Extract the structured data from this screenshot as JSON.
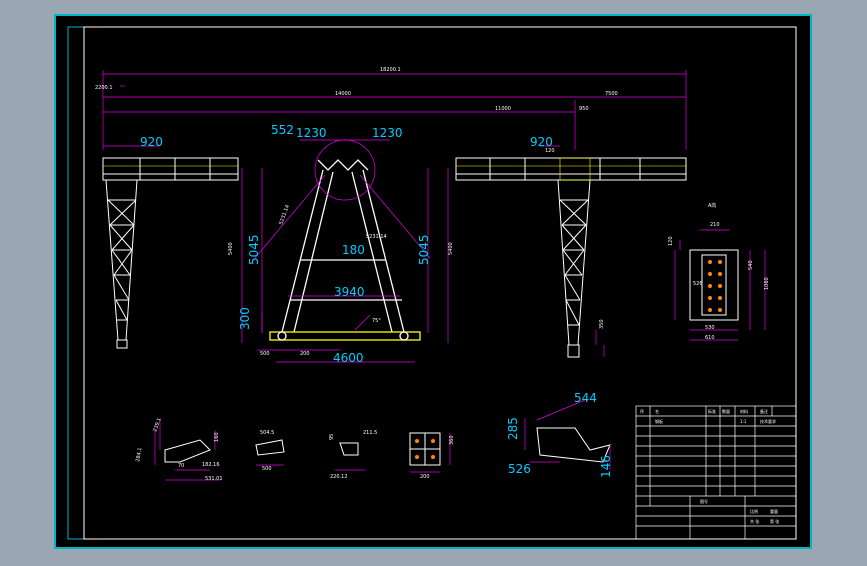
{
  "colors": {
    "background": "#9aa6b2",
    "sheet": "#000000",
    "frame": "#ffffff",
    "border": "#00b4c8",
    "structure": "#ffffff",
    "dimension": "#e000e0",
    "accent": "#ffff00"
  },
  "dims": {
    "overall": "18200.1",
    "left_overhang": "2200.1",
    "main_span": "14000",
    "span_right": "11000",
    "right_segment": "7500",
    "right_small": "950",
    "left_920": "920",
    "right_920": "920",
    "d552": "552",
    "d1230a": "1230",
    "d1230b": "1230",
    "right_120": "120",
    "left_height": "5045",
    "right_height": "5045",
    "outer_left_h": "5400",
    "outer_right_h": "5400",
    "d180": "180",
    "d3940": "3940",
    "d300": "300",
    "d4600": "4600",
    "d200": "200",
    "d500": "500",
    "d350": "350",
    "slant1": "5231.14",
    "slant2": "5231.14",
    "angle": "75°"
  },
  "section_a": {
    "label": "A向",
    "w210": "210",
    "h120": "120",
    "d540": "540",
    "d1060": "1060",
    "d530": "530",
    "d610": "610",
    "d526": "526"
  },
  "details": {
    "d1_a": "239.1",
    "d1_b": "284.1",
    "d1_c": "70",
    "d1_d": "160",
    "d1_e": "182.16",
    "d1_f": "531.01",
    "d2_a": "504.5",
    "d2_b": "500",
    "d3_a": "211.5",
    "d3_b": "220.12",
    "d3_c": "95",
    "d4_a": "200",
    "d4_b": "360",
    "d5_a": "285",
    "d5_b": "544",
    "d5_c": "526",
    "d5_d": "146"
  },
  "title_block": {
    "rows": [
      "序",
      "名",
      "标准",
      "数量",
      "材料",
      "备注"
    ],
    "cells": [
      "钢板",
      "1:1",
      "技术要求",
      "图号",
      "比例",
      "重量",
      "共 张",
      "第 张"
    ]
  }
}
